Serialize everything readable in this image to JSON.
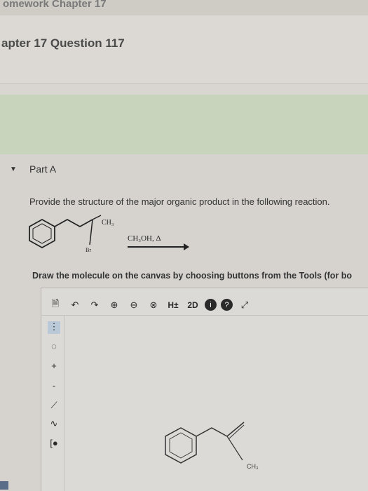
{
  "header": {
    "breadcrumb": "omework Chapter 17",
    "question_title": "apter 17 Question 117"
  },
  "part": {
    "label": "Part A"
  },
  "question": {
    "instruction": "Provide the structure of the major organic product in the following reaction.",
    "reagent": "CH₃OH, Δ",
    "substituent_ch3": "CH₃",
    "substituent_br": "Br"
  },
  "canvas": {
    "instruction": "Draw the molecule on the canvas by choosing buttons from the Tools (for bo",
    "toolbar": {
      "hydrogen_label": "H±",
      "twod_label": "2D",
      "info_label": "i",
      "help_label": "?"
    },
    "product_label": "CH₃"
  }
}
